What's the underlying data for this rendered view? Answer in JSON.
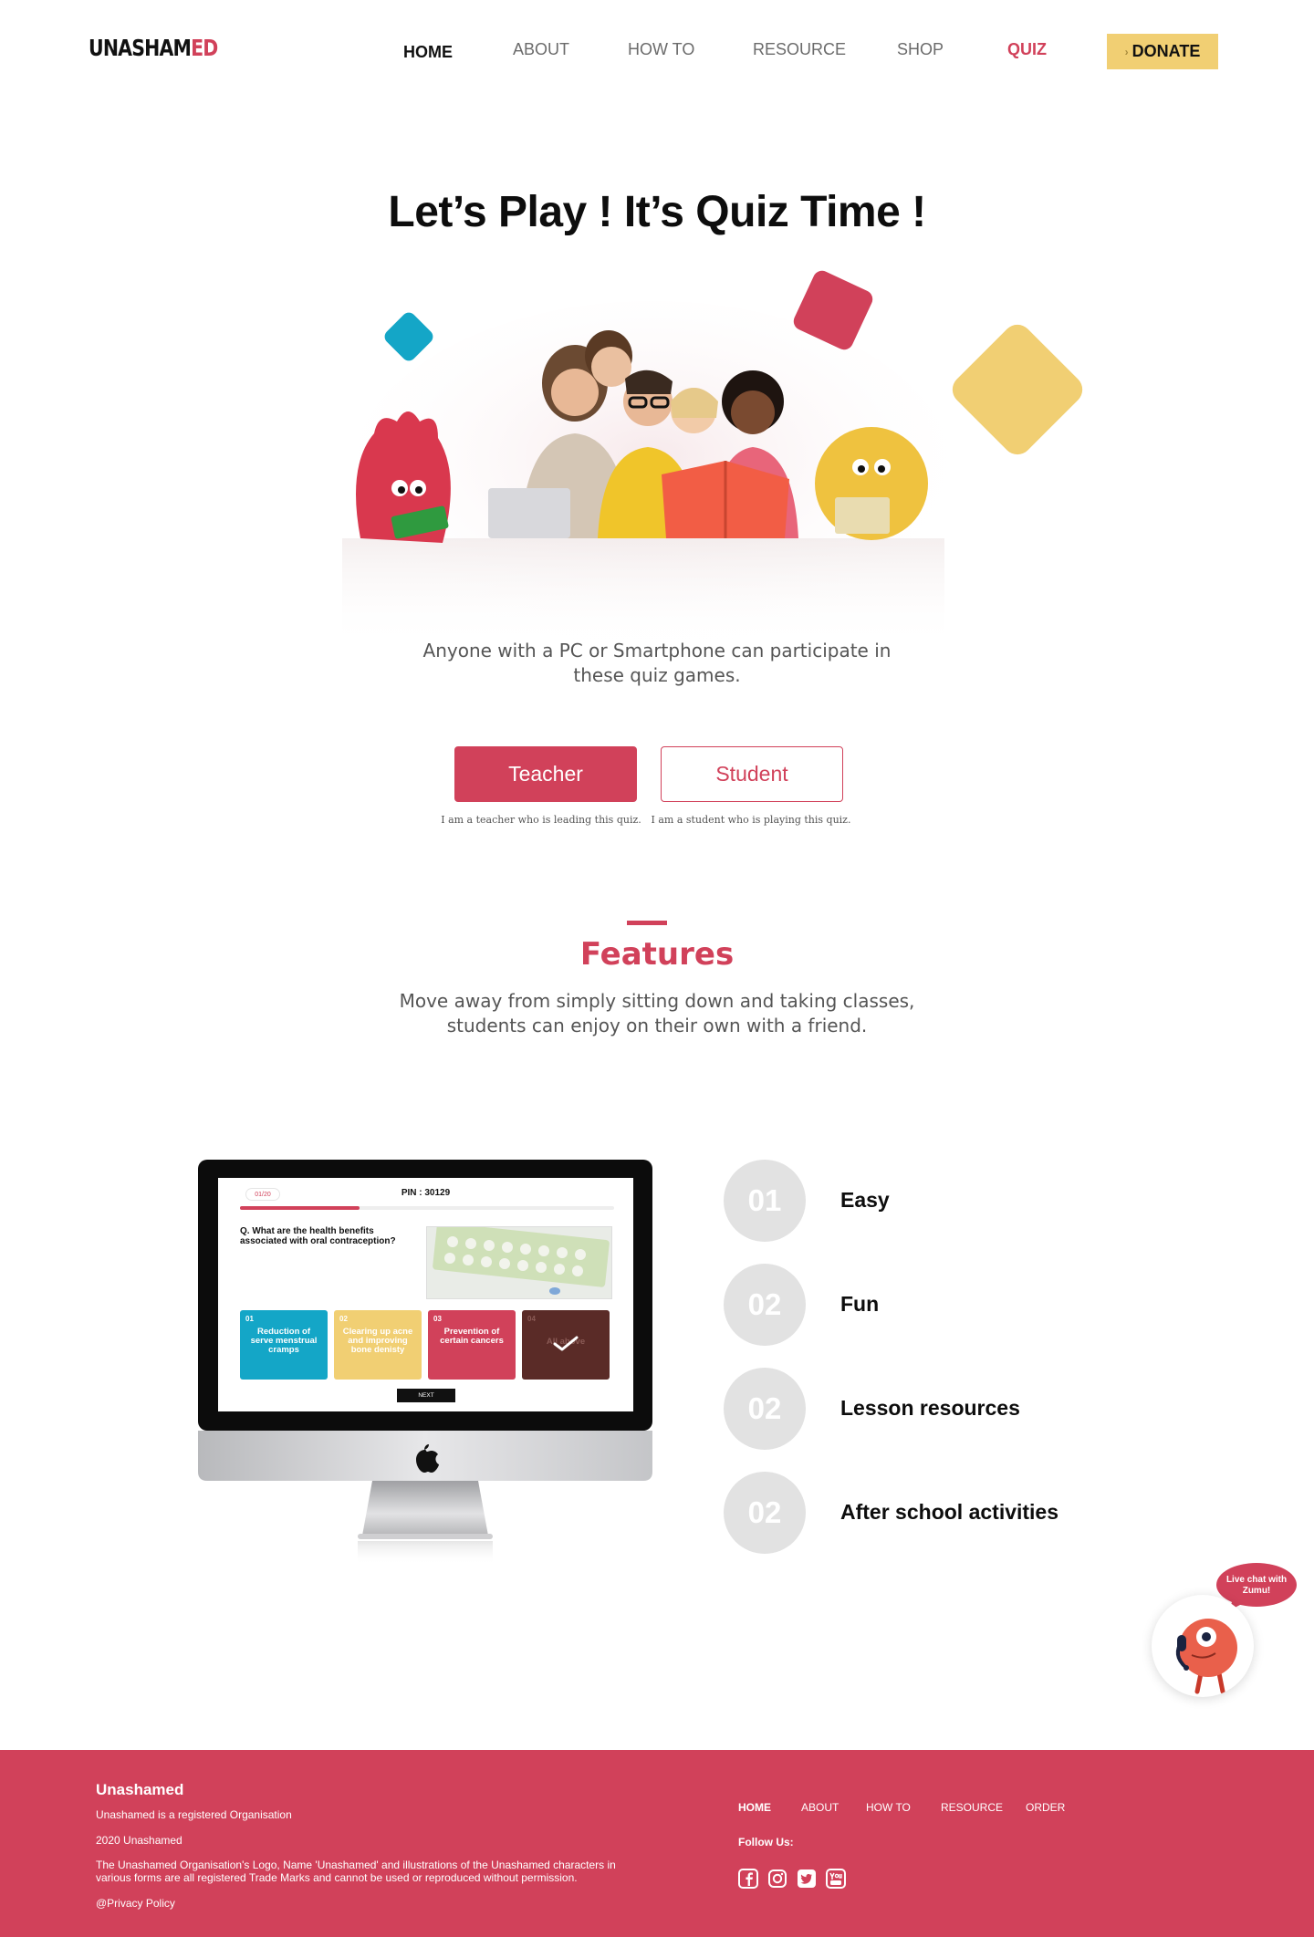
{
  "header": {
    "logo_part1": "UNASHAM",
    "logo_part2": "ED",
    "nav": [
      "HOME",
      "ABOUT",
      "HOW TO",
      "RESOURCE",
      "SHOP",
      "QUIZ"
    ],
    "donate_label": "DONATE"
  },
  "hero": {
    "title": "Let’s Play ! It’s Quiz Time !",
    "subtitle": "Anyone with a PC or Smartphone can participate in these quiz games.",
    "teacher_label": "Teacher",
    "teacher_note": "I am a teacher who is leading this quiz.",
    "student_label": "Student",
    "student_note": "I am a student who is playing this quiz."
  },
  "features": {
    "title": "Features",
    "subtitle": "Move away from simply sitting down and taking classes, students can enjoy on their own with a friend.",
    "items": [
      {
        "number": "01",
        "label": "Easy"
      },
      {
        "number": "02",
        "label": "Fun"
      },
      {
        "number": "02",
        "label": "Lesson resources"
      },
      {
        "number": "02",
        "label": "After school activities"
      }
    ]
  },
  "quiz_preview": {
    "counter": "01/20",
    "pin": "PIN : 30129",
    "progress": 0.32,
    "question": "Q. What are the health benefits associated with oral contraception?",
    "answers": [
      {
        "number": "01",
        "text": "Reduction of serve menstrual cramps"
      },
      {
        "number": "02",
        "text": "Clearing up acne and improving bone denisty"
      },
      {
        "number": "03",
        "text": "Prevention of certain cancers"
      },
      {
        "number": "04",
        "text": "All above"
      }
    ],
    "next_label": "NEXT"
  },
  "chat": {
    "label": "Live chat with Zumu!"
  },
  "footer": {
    "brand": "Unashamed",
    "registered": "Unashamed is a registered Organisation",
    "year": "2020 Unashamed",
    "legal": "The Unashamed Organisation's Logo, Name 'Unashamed' and illustrations of the Unashamed characters in various forms are all registered Trade Marks and cannot be used or reproduced without permission.",
    "privacy": "@Privacy Policy",
    "nav": [
      "HOME",
      "ABOUT",
      "HOW TO",
      "RESOURCE",
      "ORDER"
    ],
    "follow_label": "Follow Us:",
    "social": [
      "facebook-icon",
      "instagram-icon",
      "twitter-icon",
      "youtube-icon"
    ]
  },
  "colors": {
    "brand_red": "#d1415a",
    "yellow": "#f1cf73",
    "teal": "#14a6c7",
    "circle_gray": "#e2e2e2"
  }
}
